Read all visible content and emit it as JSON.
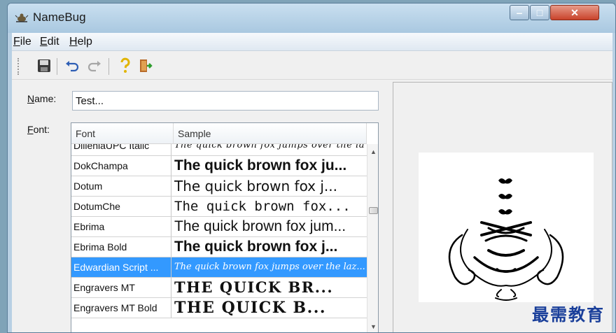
{
  "window": {
    "title": "NameBug",
    "minimize_glyph": "‒",
    "maximize_glyph": "□",
    "close_glyph": "✕"
  },
  "menu": {
    "items": [
      {
        "label": "File",
        "mnemonic": "F",
        "rest": "ile"
      },
      {
        "label": "Edit",
        "mnemonic": "E",
        "rest": "dit"
      },
      {
        "label": "Help",
        "mnemonic": "H",
        "rest": "elp"
      }
    ]
  },
  "toolbar": {
    "buttons": [
      "save-icon",
      "undo-icon",
      "redo-icon",
      "help-icon",
      "exit-icon"
    ]
  },
  "form": {
    "name_label_mnemonic": "N",
    "name_label_rest": "ame:",
    "name_value": "Test...",
    "font_label_mnemonic": "F",
    "font_label_rest": "ont:"
  },
  "font_list": {
    "columns": [
      "Font",
      "Sample"
    ],
    "rows": [
      {
        "font": "DilleniaUPC Italic",
        "sample": "The quick brown fox jumps over the lazy dog",
        "selected": false
      },
      {
        "font": "DokChampa",
        "sample": "The quick brown fox ju...",
        "selected": false
      },
      {
        "font": "Dotum",
        "sample": "The quick brown fox j...",
        "selected": false
      },
      {
        "font": "DotumChe",
        "sample": "The quick brown fox...",
        "selected": false
      },
      {
        "font": "Ebrima",
        "sample": "The quick brown fox jum...",
        "selected": false
      },
      {
        "font": "Ebrima Bold",
        "sample": "The quick brown fox j...",
        "selected": false
      },
      {
        "font": "Edwardian Script ...",
        "sample": "The quick brown fox jumps over the laz...",
        "selected": true
      },
      {
        "font": "Engravers MT",
        "sample": "THE QUICK BR...",
        "selected": false
      },
      {
        "font": "Engravers MT Bold",
        "sample": "THE QUICK B...",
        "selected": false
      }
    ]
  },
  "watermark": "最需教育",
  "colors": {
    "selection": "#3399ff",
    "close_button": "#c9432b"
  }
}
